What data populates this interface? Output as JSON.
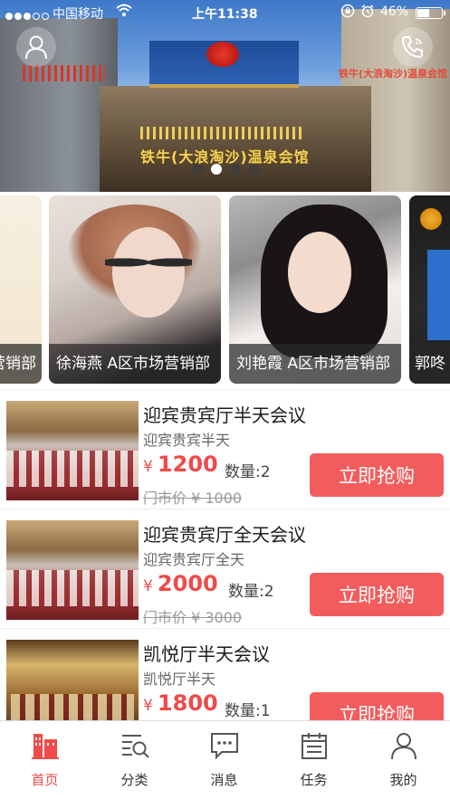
{
  "status_bar": {
    "carrier": "中国移动",
    "time": "上午11:38",
    "battery": "46%",
    "battery_level": 0.46
  },
  "banner": {
    "sign_top_right": "铁牛(大浪淘沙)温泉会馆",
    "sign_main": "铁牛(大浪淘沙)温泉会馆",
    "active_slide": 2,
    "slide_count": 4,
    "icons": [
      "user-icon",
      "phone-icon"
    ]
  },
  "staff": [
    {
      "caption": "营销部"
    },
    {
      "caption": "徐海燕 A区市场营销部"
    },
    {
      "caption": "刘艳霞 A区市场营销部"
    },
    {
      "caption": "郭咚"
    }
  ],
  "products": [
    {
      "title": "迎宾贵宾厅半天会议",
      "subtitle": "迎宾贵宾半天",
      "currency": "¥",
      "price": "1200",
      "qty": "数量:2",
      "orig": "门市价 ¥ 1000",
      "buy": "立即抢购"
    },
    {
      "title": "迎宾贵宾厅全天会议",
      "subtitle": "迎宾贵宾厅全天",
      "currency": "¥",
      "price": "2000",
      "qty": "数量:2",
      "orig": "门市价 ¥ 3000",
      "buy": "立即抢购"
    },
    {
      "title": "凯悦厅半天会议",
      "subtitle": "凯悦厅半天",
      "currency": "¥",
      "price": "1800",
      "qty": "数量:1",
      "orig": "",
      "buy": "立即抢购"
    }
  ],
  "tabs": [
    {
      "label": "首页",
      "icon": "home-icon",
      "active": true
    },
    {
      "label": "分类",
      "icon": "category-search-icon",
      "active": false
    },
    {
      "label": "消息",
      "icon": "message-icon",
      "active": false
    },
    {
      "label": "任务",
      "icon": "task-calendar-icon",
      "active": false
    },
    {
      "label": "我的",
      "icon": "profile-icon",
      "active": false
    }
  ],
  "colors": {
    "accent": "#f04a4a",
    "buy_button": "#f35c5c"
  }
}
